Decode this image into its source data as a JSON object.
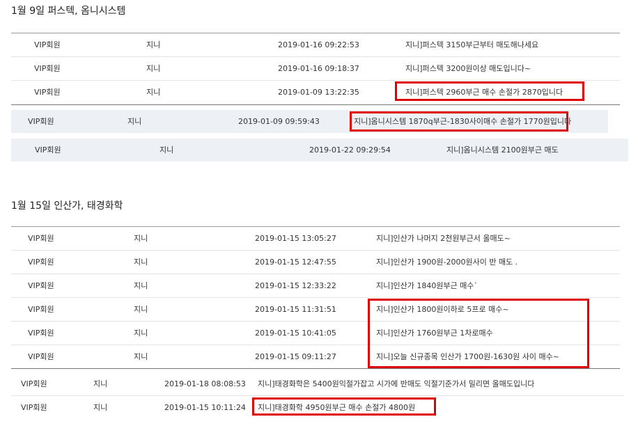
{
  "sections": [
    {
      "title": "1월 9일 퍼스텍, 옴니시스템",
      "rows": [
        {
          "grade": "VIP회원",
          "author": "지니",
          "date": "2019-01-16 09:22:53",
          "subject": "지니]퍼스텍 3150부근부터 매도해나세요"
        },
        {
          "grade": "VIP회원",
          "author": "지니",
          "date": "2019-01-16 09:18:37",
          "subject": "지니]퍼스텍 3200원이상 매도입니다~"
        },
        {
          "grade": "VIP회원",
          "author": "지니",
          "date": "2019-01-09 13:22:35",
          "subject": "지니]퍼스텍 2960부근 매수 손절가 2870입니다"
        },
        {
          "grade": "VIP회원",
          "author": "지니",
          "date": "2019-01-09 09:59:43",
          "subject": "지니]옴니시스템 1870q부근-1830사이매수 손절가 1770원입니다"
        },
        {
          "grade": "VIP회원",
          "author": "지니",
          "date": "2019-01-22 09:29:54",
          "subject": "지니]옴니시스템 2100원부근 매도"
        }
      ]
    },
    {
      "title": "1월 15일 인산가, 태경화학",
      "rows": [
        {
          "grade": "VIP회원",
          "author": "지니",
          "date": "2019-01-15 13:05:27",
          "subject": "지니]인산가 나머지 2천원부근서 올매도~"
        },
        {
          "grade": "VIP회원",
          "author": "지니",
          "date": "2019-01-15 12:47:55",
          "subject": "지니]인산가 1900원-2000원사이 반 매도 ."
        },
        {
          "grade": "VIP회원",
          "author": "지니",
          "date": "2019-01-15 12:33:22",
          "subject": "지니]인산가 1840원부근 매수`"
        },
        {
          "grade": "VIP회원",
          "author": "지니",
          "date": "2019-01-15 11:31:51",
          "subject": "지니]인산가 1800원이하로 5프로 매수~"
        },
        {
          "grade": "VIP회원",
          "author": "지니",
          "date": "2019-01-15 10:41:05",
          "subject": "지니]인산가 1760원부근 1차로매수"
        },
        {
          "grade": "VIP회원",
          "author": "지니",
          "date": "2019-01-15 09:11:27",
          "subject": "지니]오늘 신규종목 인산가 1700원-1630원 사이 매수~"
        },
        {
          "grade": "VIP회원",
          "author": "지니",
          "date": "2019-01-18 08:08:53",
          "subject": "지니]태경화학은 5400원익절가잡고 시가에 반매도 익절기준가서 밀리면 올매도입니다"
        },
        {
          "grade": "VIP회원",
          "author": "지니",
          "date": "2019-01-15 10:11:24",
          "subject": "지니]태경화학 4950원부근 매수 손절가 4800원"
        }
      ]
    }
  ],
  "highlight_color": "#e00000"
}
